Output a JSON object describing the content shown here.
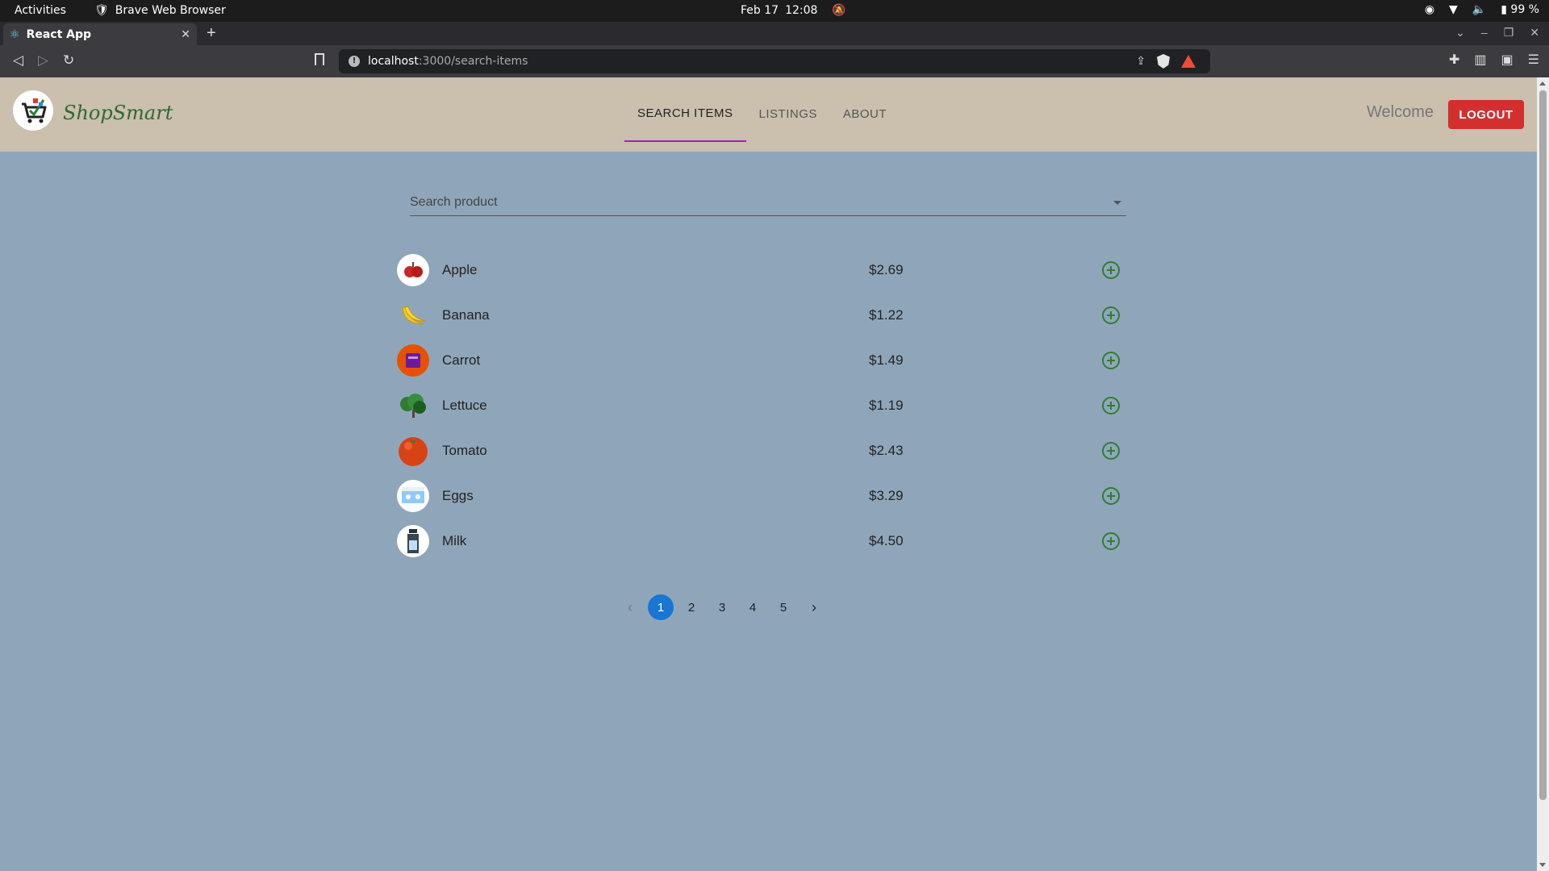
{
  "os": {
    "activities": "Activities",
    "app_name": "Brave Web Browser",
    "date": "Feb 17",
    "time": "12:08",
    "battery": "99 %"
  },
  "browser": {
    "tab_title": "React App",
    "url_host": "localhost",
    "url_path": ":3000/search-items"
  },
  "app": {
    "logo_text": "ShopSmart",
    "nav": [
      {
        "label": "SEARCH ITEMS",
        "active": true
      },
      {
        "label": "LISTINGS",
        "active": false
      },
      {
        "label": "ABOUT",
        "active": false
      }
    ],
    "welcome": "Welcome",
    "logout": "LOGOUT",
    "search_placeholder": "Search product"
  },
  "products": [
    {
      "name": "Apple",
      "price": "$2.69",
      "icon": "apple-icon",
      "color": "#c62828"
    },
    {
      "name": "Banana",
      "price": "$1.22",
      "icon": "banana-icon",
      "color": "#f4c430"
    },
    {
      "name": "Carrot",
      "price": "$1.49",
      "icon": "carrot-icon",
      "color": "#e65100"
    },
    {
      "name": "Lettuce",
      "price": "$1.19",
      "icon": "lettuce-icon",
      "color": "#388e3c"
    },
    {
      "name": "Tomato",
      "price": "$2.43",
      "icon": "tomato-icon",
      "color": "#d84315"
    },
    {
      "name": "Eggs",
      "price": "$3.29",
      "icon": "eggs-icon",
      "color": "#90a4ae"
    },
    {
      "name": "Milk",
      "price": "$4.50",
      "icon": "milk-icon",
      "color": "#37474f"
    }
  ],
  "pagination": {
    "pages": [
      "1",
      "2",
      "3",
      "4",
      "5"
    ],
    "current": "1"
  },
  "colors": {
    "accent_nav": "#9c27b0",
    "logout_bg": "#d32f2f",
    "page_active": "#1976d2",
    "add_icon": "#2e7d32",
    "page_bg": "#8fa6ba",
    "header_bg": "#cbbfae"
  }
}
